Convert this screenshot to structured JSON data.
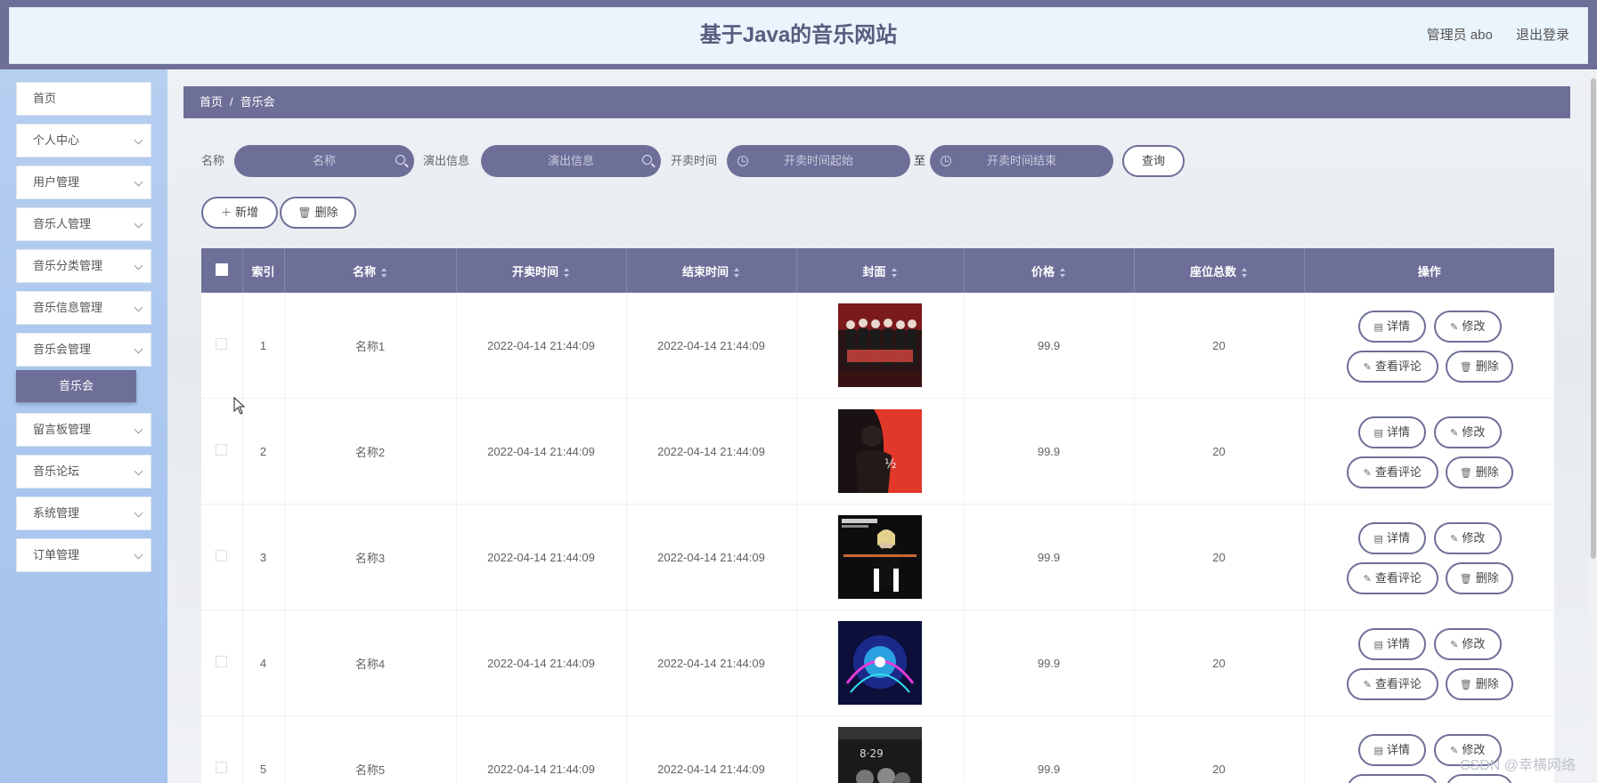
{
  "header": {
    "title": "基于Java的音乐网站",
    "admin_label": "管理员 abo",
    "logout": "退出登录"
  },
  "sidebar": {
    "items": [
      {
        "label": "首页",
        "has_sub": false
      },
      {
        "label": "个人中心",
        "has_sub": true
      },
      {
        "label": "用户管理",
        "has_sub": true
      },
      {
        "label": "音乐人管理",
        "has_sub": true
      },
      {
        "label": "音乐分类管理",
        "has_sub": true
      },
      {
        "label": "音乐信息管理",
        "has_sub": true
      },
      {
        "label": "音乐会管理",
        "has_sub": true
      },
      {
        "label": "留言板管理",
        "has_sub": true
      },
      {
        "label": "音乐论坛",
        "has_sub": true
      },
      {
        "label": "系统管理",
        "has_sub": true
      },
      {
        "label": "订单管理",
        "has_sub": true
      }
    ],
    "active_sub": "音乐会"
  },
  "breadcrumb": {
    "home": "首页",
    "separator": "/",
    "current": "音乐会"
  },
  "search": {
    "name_label": "名称",
    "name_placeholder": "名称",
    "info_label": "演出信息",
    "info_placeholder": "演出信息",
    "time_label": "开卖时间",
    "time_start_placeholder": "开卖时间起始",
    "time_to": "至",
    "time_end_placeholder": "开卖时间结束",
    "query_button": "查询"
  },
  "actions": {
    "add": "新增",
    "delete": "删除"
  },
  "table": {
    "headers": [
      "索引",
      "名称",
      "开卖时间",
      "结束时间",
      "封面",
      "价格",
      "座位总数",
      "操作"
    ],
    "rows": [
      {
        "index": "1",
        "name": "名称1",
        "start": "2022-04-14 21:44:09",
        "end": "2022-04-14 21:44:09",
        "price": "99.9",
        "seats": "20"
      },
      {
        "index": "2",
        "name": "名称2",
        "start": "2022-04-14 21:44:09",
        "end": "2022-04-14 21:44:09",
        "price": "99.9",
        "seats": "20"
      },
      {
        "index": "3",
        "name": "名称3",
        "start": "2022-04-14 21:44:09",
        "end": "2022-04-14 21:44:09",
        "price": "99.9",
        "seats": "20"
      },
      {
        "index": "4",
        "name": "名称4",
        "start": "2022-04-14 21:44:09",
        "end": "2022-04-14 21:44:09",
        "price": "99.9",
        "seats": "20"
      },
      {
        "index": "5",
        "name": "名称5",
        "start": "2022-04-14 21:44:09",
        "end": "2022-04-14 21:44:09",
        "price": "99.9",
        "seats": "20"
      }
    ],
    "ops": {
      "detail": "详情",
      "edit": "修改",
      "comments": "查看评论",
      "delete": "删除"
    }
  },
  "watermark": "CSDN @幸横网络",
  "colors": {
    "accent": "#6d6f98",
    "header_bg": "#eaf4fc",
    "sidebar_bg": "#b0caef"
  }
}
